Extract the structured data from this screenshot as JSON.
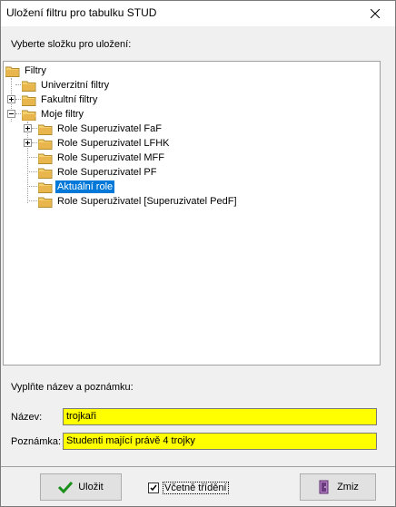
{
  "window": {
    "title": "Uložení filtru pro tabulku STUD"
  },
  "prompt_folder": "Vyberte složku pro uložení:",
  "tree": {
    "root": "Filtry",
    "items": [
      {
        "label": "Univerzitní filtry"
      },
      {
        "label": "Fakultní filtry"
      },
      {
        "label": "Moje filtry"
      },
      {
        "label": "Role Superuzivatel FaF"
      },
      {
        "label": "Role Superuzivatel LFHK"
      },
      {
        "label": "Role Superuzivatel MFF"
      },
      {
        "label": "Role Superuzivatel PF"
      },
      {
        "label": "Aktuální role",
        "selected": true
      },
      {
        "label": "Role Superuživatel [Superuzivatel PedF]"
      }
    ]
  },
  "prompt_name": "Vyplňte název a poznámku:",
  "name": {
    "label": "Název:",
    "value": "trojkaři"
  },
  "note": {
    "label": "Poznámka:",
    "value": "Studenti mající právě 4 trojky"
  },
  "buttons": {
    "save": "Uložit",
    "cancel": "Zmiz"
  },
  "checkbox": {
    "label": "Včetně třídění",
    "checked": true
  },
  "colors": {
    "selection": "#0078d7",
    "field": "#ffff00",
    "folder": "#e8b64c"
  }
}
